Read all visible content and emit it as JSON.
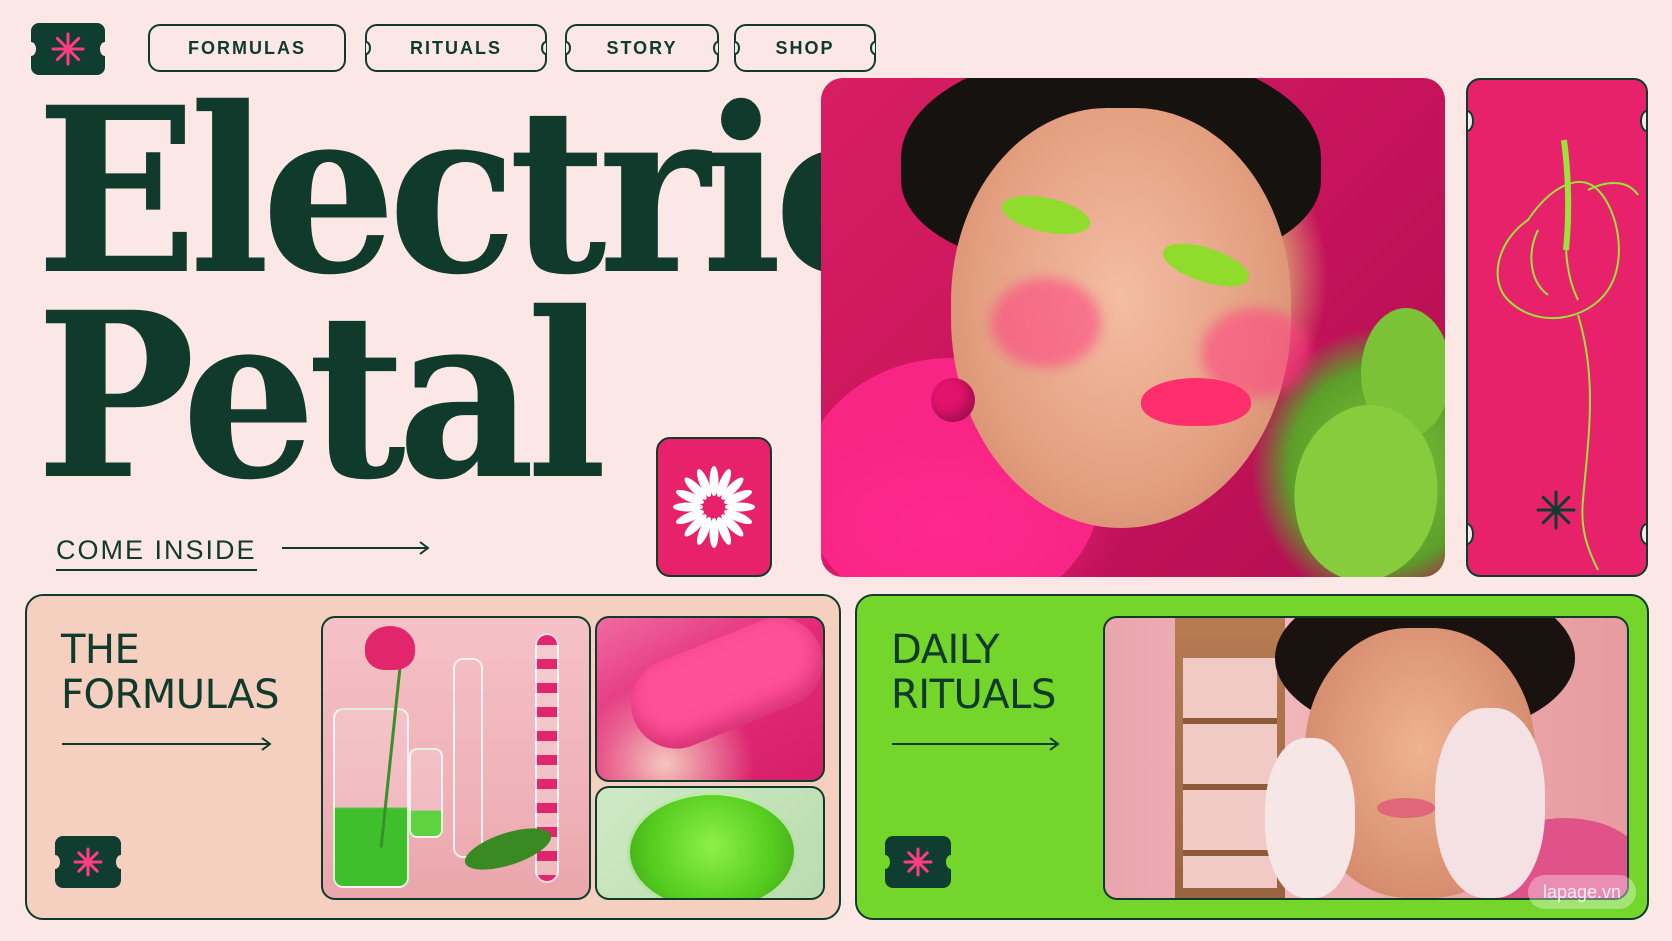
{
  "nav": {
    "items": [
      {
        "label": "FORMULAS"
      },
      {
        "label": "RITUALS"
      },
      {
        "label": "STORY"
      },
      {
        "label": "SHOP"
      }
    ]
  },
  "hero": {
    "headline_line1": "Electric",
    "headline_line2": "Petal",
    "cta_label": "COME INSIDE"
  },
  "cards": {
    "formulas": {
      "title_line1": "THE",
      "title_line2": "FORMULAS"
    },
    "rituals": {
      "title_line1": "DAILY",
      "title_line2": "RITUALS"
    }
  },
  "watermark": "lapage.vn",
  "colors": {
    "background": "#fbe7e6",
    "ink": "#0f3a2c",
    "accent_pink": "#e8226a",
    "accent_green": "#74d62b",
    "card_peach": "#f5cfc0"
  },
  "icons": [
    "asterisk-icon",
    "flower-burst-icon",
    "arrow-right-icon",
    "anthurium-line-icon"
  ]
}
